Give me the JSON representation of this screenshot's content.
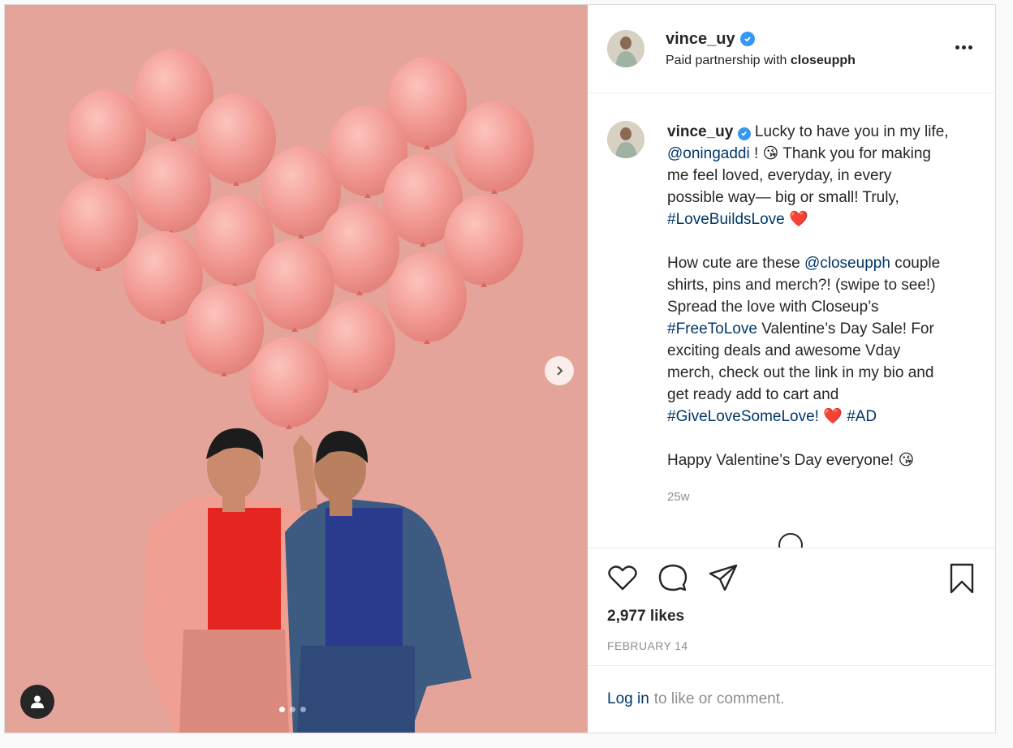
{
  "post": {
    "username": "vince_uy",
    "partnership_prefix": "Paid partnership with",
    "partner": "closeupph",
    "caption": {
      "p1_a": "Lucky to have you in my life,",
      "mention1": "@oningaddi",
      "p1_b": "! 😘 Thank you for making me feel loved, everyday, in every possible way— big or small! Truly,",
      "hashtag1": "#LoveBuildsLove",
      "p1_c": "❤️",
      "p2_a": "How cute are these",
      "mention2": "@closeupph",
      "p2_b": "couple shirts, pins and merch?! (swipe to see!) Spread the love with Closeup’s",
      "hashtag2": "#FreeToLove",
      "p2_c": "Valentine’s Day Sale! For exciting deals and awesome Vday merch, check out the link in my bio and get ready add to cart and",
      "hashtag3": "#GiveLoveSomeLove!",
      "p2_d": "❤️",
      "hashtag4": "#AD",
      "p3": "Happy Valentine’s Day everyone! 😘"
    },
    "timestamp": "25w",
    "likes": "2,977 likes",
    "date": "FEBRUARY 14",
    "login_link": "Log in",
    "login_rest": "to like or comment."
  },
  "carousel": {
    "current": 1,
    "total": 3
  },
  "colors": {
    "background": "#e4a49a",
    "balloon": "#f29a93",
    "link": "#00376b",
    "verified": "#3897f0"
  },
  "icons": [
    "verified-icon",
    "more-options-icon",
    "heart-icon",
    "comment-icon",
    "share-icon",
    "bookmark-icon",
    "chevron-right-icon",
    "user-tag-icon"
  ]
}
